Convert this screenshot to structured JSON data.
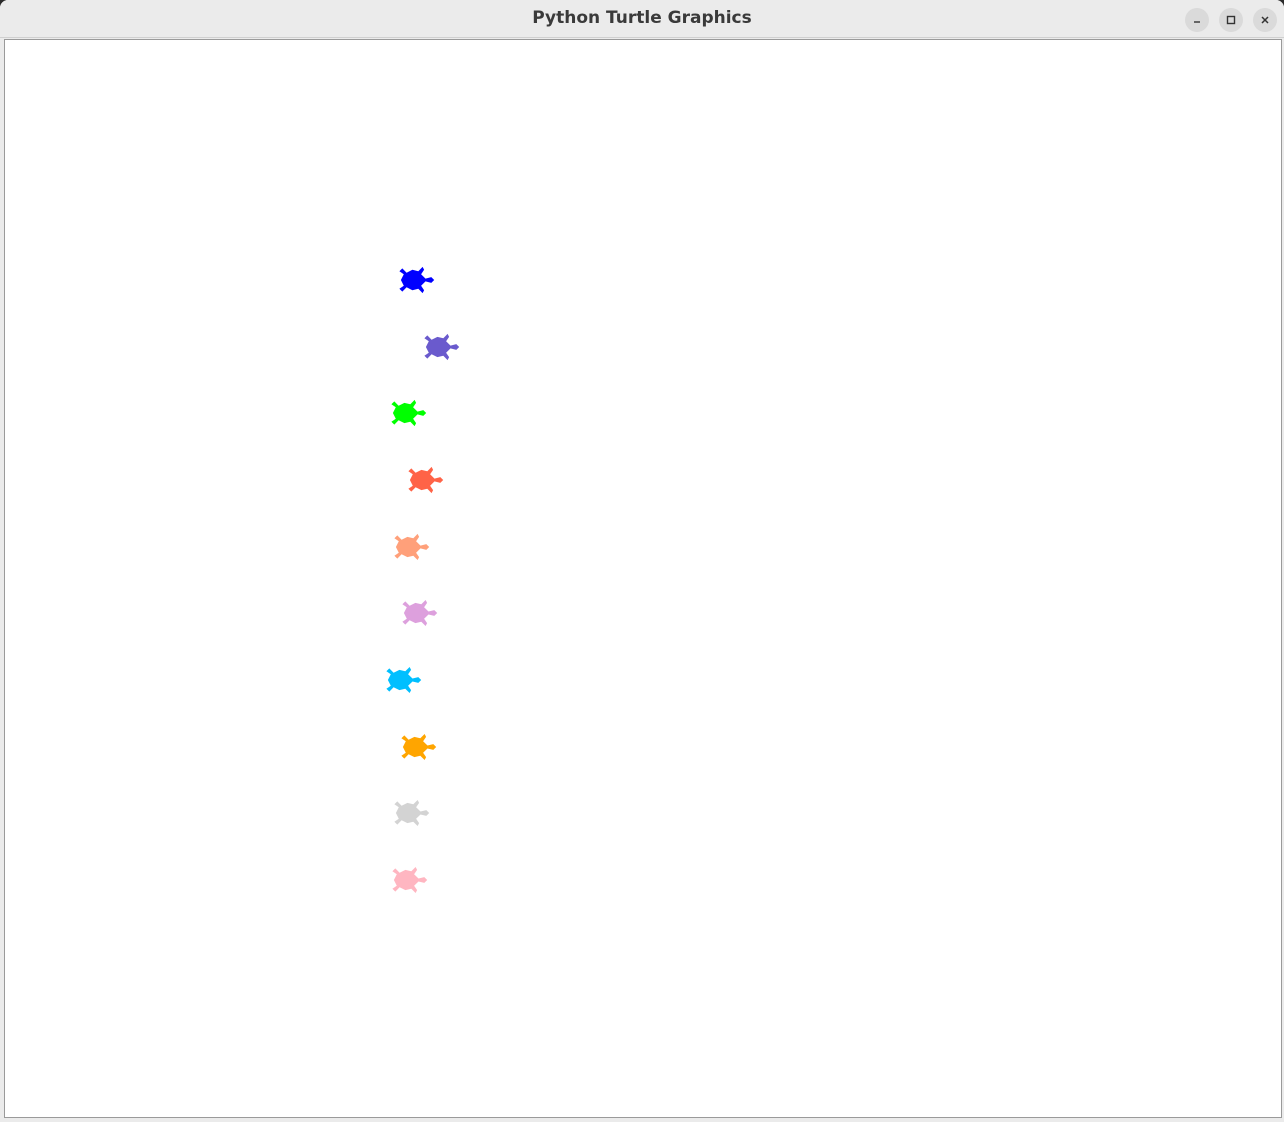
{
  "window": {
    "title": "Python Turtle Graphics",
    "controls": [
      {
        "name": "minimize-button",
        "icon": "minimize-icon"
      },
      {
        "name": "maximize-button",
        "icon": "maximize-icon"
      },
      {
        "name": "close-button",
        "icon": "close-icon"
      }
    ]
  },
  "canvas": {
    "background": "#ffffff",
    "turtles": [
      {
        "color": "#0000ff",
        "shape": "turtle",
        "heading": "east"
      },
      {
        "color": "#6a5acd",
        "shape": "turtle",
        "heading": "east"
      },
      {
        "color": "#00ff00",
        "shape": "turtle",
        "heading": "east"
      },
      {
        "color": "#ff6347",
        "shape": "turtle",
        "heading": "east"
      },
      {
        "color": "#ffa07a",
        "shape": "turtle",
        "heading": "east"
      },
      {
        "color": "#dda0dd",
        "shape": "turtle",
        "heading": "east"
      },
      {
        "color": "#00bfff",
        "shape": "turtle",
        "heading": "east"
      },
      {
        "color": "#ffa500",
        "shape": "turtle",
        "heading": "east"
      },
      {
        "color": "#d3d3d3",
        "shape": "turtle",
        "heading": "east"
      },
      {
        "color": "#ffb6c1",
        "shape": "turtle",
        "heading": "east"
      }
    ]
  }
}
